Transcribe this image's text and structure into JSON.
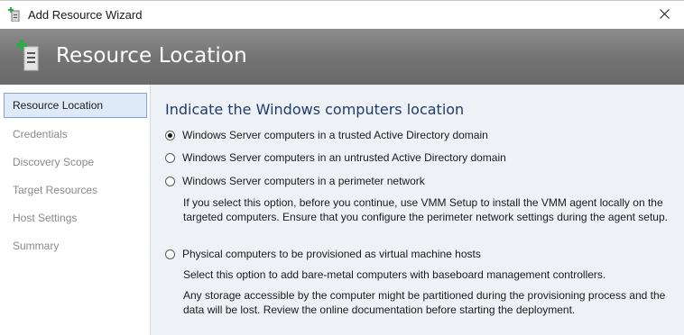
{
  "window": {
    "title": "Add Resource Wizard",
    "icon": "server-add-icon",
    "close_icon": "close-icon"
  },
  "header": {
    "title": "Resource Location",
    "icon": "server-add-icon"
  },
  "sidebar": {
    "items": [
      {
        "label": "Resource Location",
        "active": true
      },
      {
        "label": "Credentials",
        "active": false
      },
      {
        "label": "Discovery Scope",
        "active": false
      },
      {
        "label": "Target Resources",
        "active": false
      },
      {
        "label": "Host Settings",
        "active": false
      },
      {
        "label": "Summary",
        "active": false
      }
    ]
  },
  "main": {
    "heading": "Indicate the Windows computers location",
    "options": [
      {
        "label": "Windows Server computers in a trusted Active Directory domain",
        "selected": true
      },
      {
        "label": "Windows Server computers in an untrusted Active Directory domain",
        "selected": false
      },
      {
        "label": "Windows Server computers in a perimeter network",
        "selected": false
      },
      {
        "label": "Physical computers to be provisioned as virtual machine hosts",
        "selected": false
      }
    ],
    "perimeter_description": "If you select this option, before you continue, use VMM Setup to install the VMM agent locally on the targeted computers. Ensure that you configure the perimeter network settings during the agent setup.",
    "physical_description_1": "Select this option to add bare-metal computers with baseboard management controllers.",
    "physical_description_2": "Any storage accessible by the computer might be partitioned during the provisioning process and the data will be lost. Review the online documentation before starting the deployment."
  },
  "colors": {
    "header_bg": "#7a7a7a",
    "heading_text": "#1f3b6d",
    "content_bg": "#eef2f6",
    "nav_active_bg": "#dfeaf8",
    "nav_active_border": "#7ba4da",
    "icon_green": "#2fa84f"
  }
}
